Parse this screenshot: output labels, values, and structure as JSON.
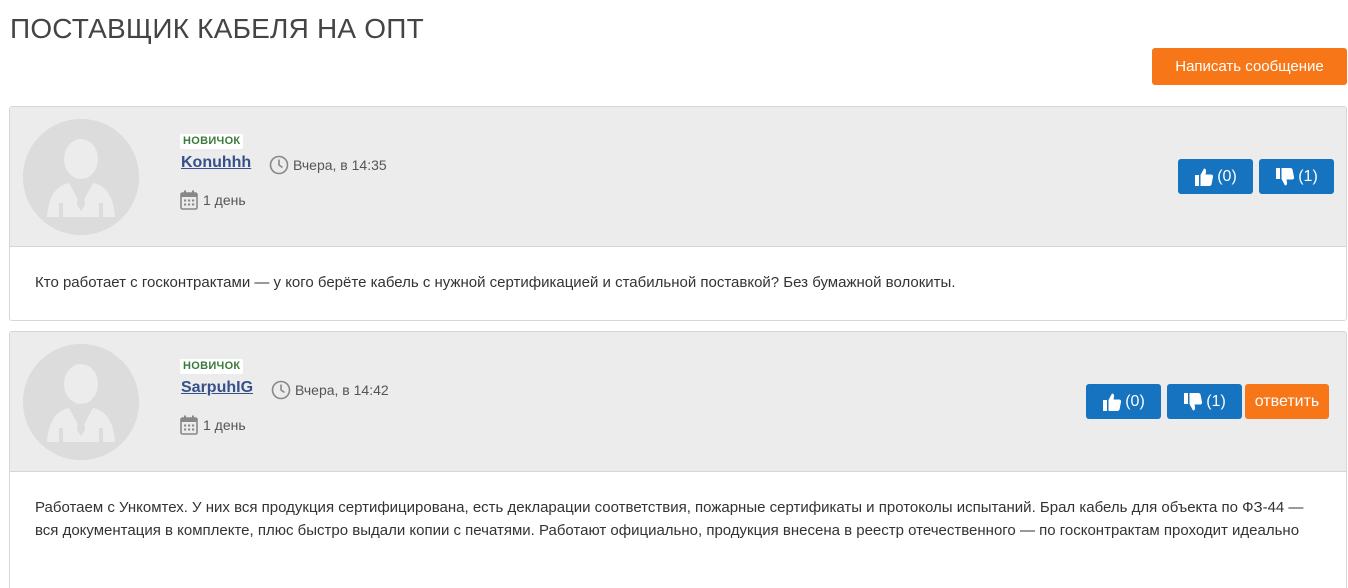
{
  "page": {
    "title": "ПОСТАВЩИК КАБЕЛЯ НА ОПТ",
    "write_button": "Написать сообщение"
  },
  "colors": {
    "accent_orange": "#f77718",
    "vote_blue": "#1573c0",
    "username_blue": "#35508a",
    "header_gray": "#ececec"
  },
  "icons": {
    "avatar": "user-silhouette-icon",
    "time": "clock-icon",
    "days": "calendar-icon",
    "like": "thumbs-up-icon",
    "dislike": "thumbs-down-icon"
  },
  "posts": [
    {
      "rank": "НОВИЧОК",
      "username": "Konuhhh",
      "time": "Вчера, в 14:35",
      "membership": "1 день",
      "likes": "(0)",
      "dislikes": "(1)",
      "text": "Кто работает с госконтрактами — у кого берёте кабель с нужной сертификацией и стабильной поставкой? Без бумажной волокиты."
    },
    {
      "rank": "НОВИЧОК",
      "username": "SarpuhIG",
      "time": "Вчера, в 14:42",
      "membership": "1 день",
      "likes": "(0)",
      "dislikes": "(1)",
      "reply_label": "ответить",
      "text": "Работаем с Ункомтех. У них вся продукция сертифицирована, есть декларации соответствия, пожарные сертификаты и протоколы испытаний. Брал кабель для объекта по ФЗ-44 — вся документация в комплекте, плюс быстро выдали копии с печатями. Работают официально, продукция внесена в реестр отечественного — по госконтрактам проходит идеально"
    }
  ]
}
